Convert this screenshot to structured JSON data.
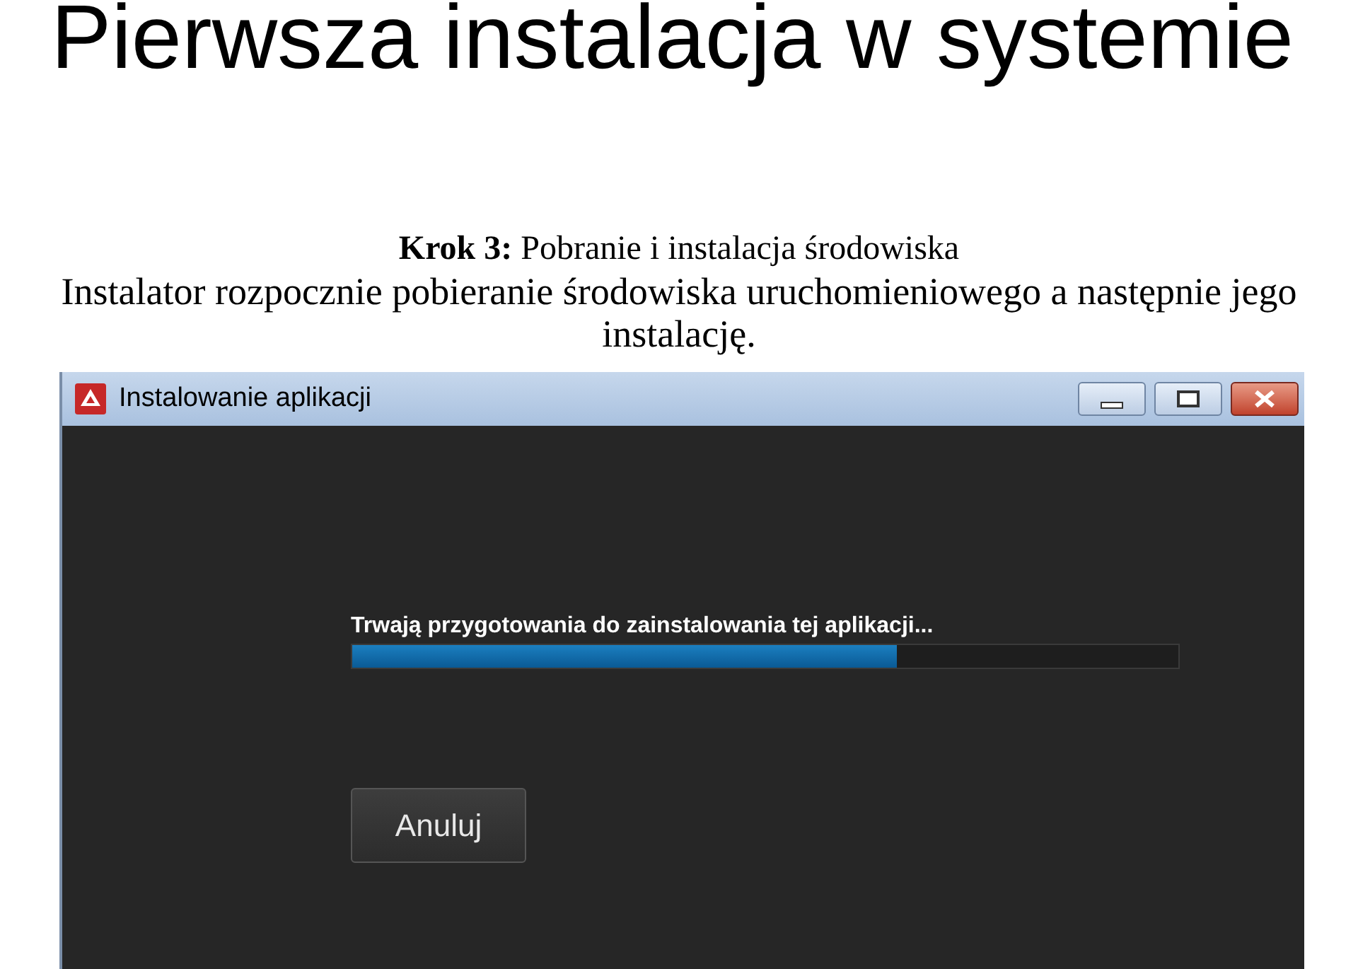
{
  "slide": {
    "title": "Pierwsza instalacja w systemie",
    "step": "**Krok 3:** Pobranie i instalacja środowiska",
    "description": "Instalator rozpocznie pobieranie środowiska uruchomieniowego a następnie jego instalację."
  },
  "window": {
    "title": "Instalowanie aplikacji",
    "status": "Trwają przygotowania do zainstalowania tej aplikacji...",
    "progress": {
      "level": 0.66
    },
    "buttons": [
      "Anuluj"
    ]
  }
}
